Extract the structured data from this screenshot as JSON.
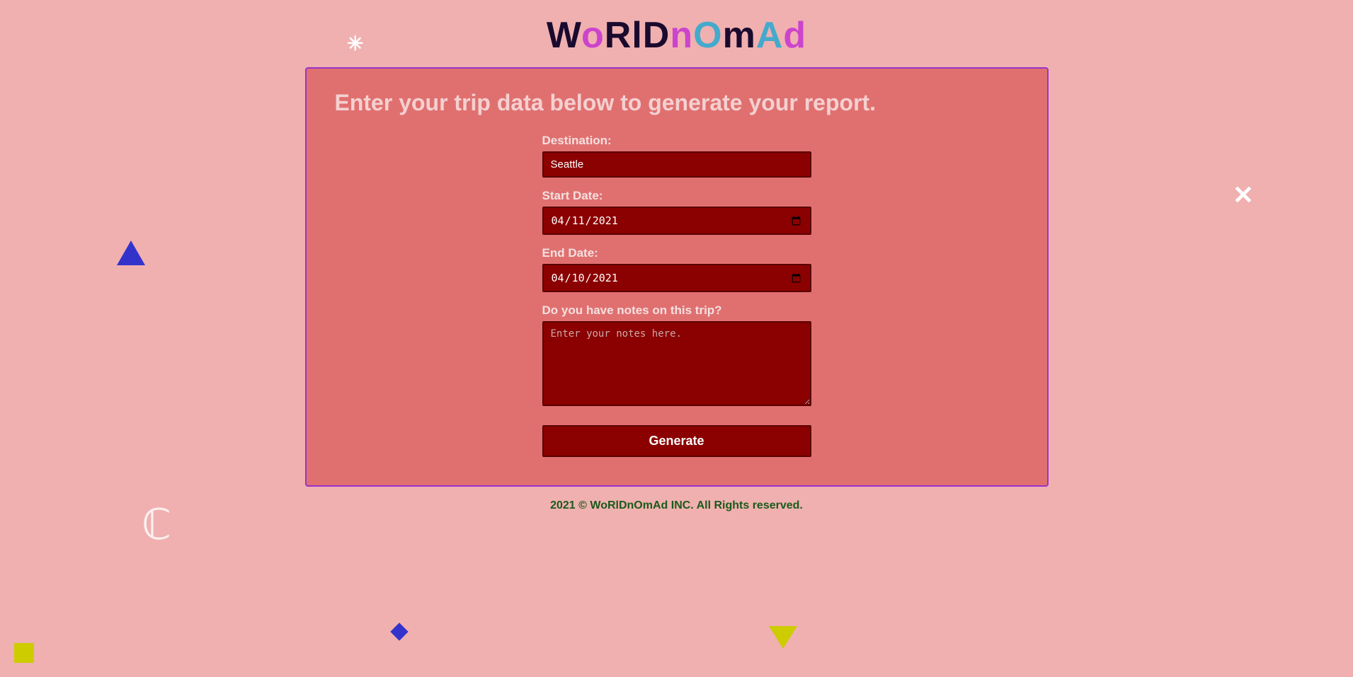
{
  "app": {
    "logo": {
      "parts": [
        {
          "char": "W",
          "class": "logo-w"
        },
        {
          "char": "o",
          "class": "logo-o1"
        },
        {
          "char": "R",
          "class": "logo-r"
        },
        {
          "char": "l",
          "class": "logo-l"
        },
        {
          "char": "D",
          "class": "logo-d"
        },
        {
          "char": "n",
          "class": "logo-n"
        },
        {
          "char": "O",
          "class": "logo-O"
        },
        {
          "char": "m",
          "class": "logo-m"
        },
        {
          "char": "A",
          "class": "logo-A"
        },
        {
          "char": "d",
          "class": "logo-d2"
        }
      ],
      "full": "WoRlDnOmAd"
    }
  },
  "form": {
    "title": "Enter your trip data below to generate your report.",
    "destination_label": "Destination:",
    "destination_value": "Seattle",
    "destination_placeholder": "Seattle",
    "start_date_label": "Start Date:",
    "start_date_value": "2021-04-11",
    "end_date_label": "End Date:",
    "end_date_value": "2021-04-10",
    "notes_label": "Do you have notes on this trip?",
    "notes_placeholder": "Enter your notes here.",
    "notes_value": "",
    "generate_label": "Generate"
  },
  "footer": {
    "text": "2021 © WoRlDnOmAd INC. All Rights reserved."
  }
}
